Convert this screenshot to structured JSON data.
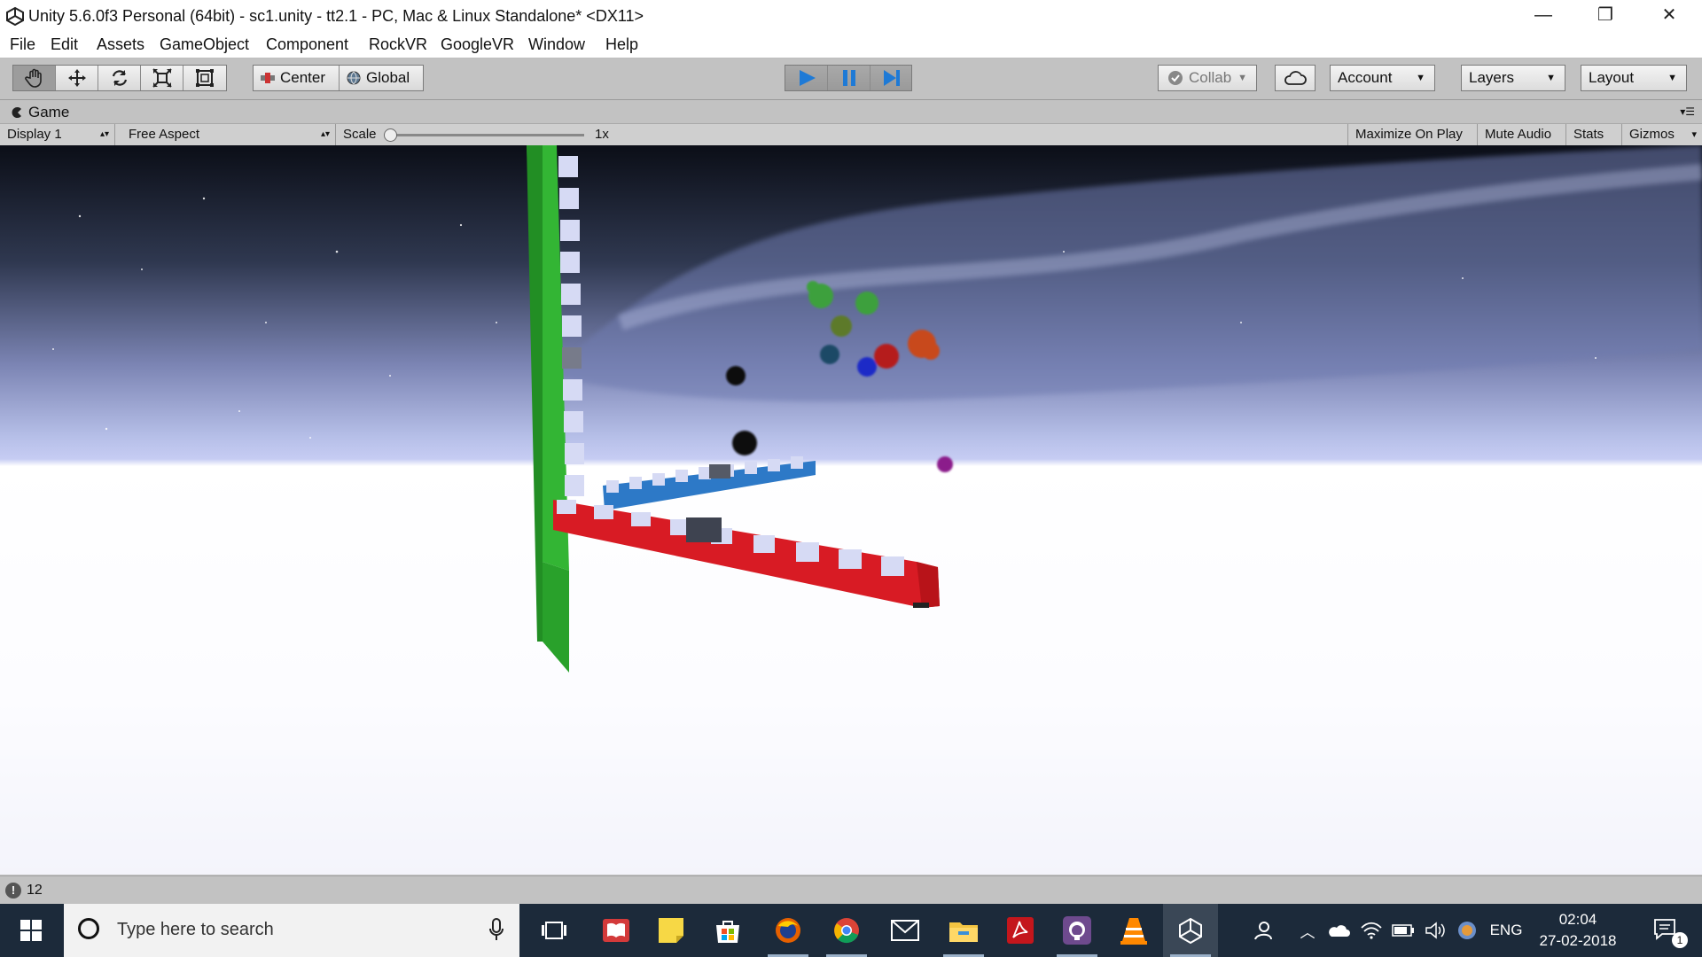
{
  "window": {
    "title": "Unity 5.6.0f3 Personal (64bit) - sc1.unity - tt2.1 - PC, Mac & Linux Standalone* <DX11>",
    "minimize": "—",
    "restore": "❐",
    "close": "✕"
  },
  "menu": [
    "File",
    "Edit",
    "Assets",
    "GameObject",
    "Component",
    "RockVR",
    "GoogleVR",
    "Window",
    "Help"
  ],
  "toolbar": {
    "tools": [
      "hand-icon",
      "move-icon",
      "rotate-icon",
      "scale-icon",
      "rect-icon"
    ],
    "pivot_label": "Center",
    "space_label": "Global",
    "collab_label": "Collab",
    "account_label": "Account",
    "layers_label": "Layers",
    "layout_label": "Layout",
    "play_color": "#1e7ad6"
  },
  "game_view": {
    "tab_label": "Game",
    "display": "Display 1",
    "aspect": "Free Aspect",
    "scale_label": "Scale",
    "scale_value": "1x",
    "scale_slider_value": 0,
    "maximize": "Maximize On Play",
    "mute": "Mute Audio",
    "stats": "Stats",
    "gizmos": "Gizmos"
  },
  "status": {
    "count": "12"
  },
  "taskbar": {
    "search_placeholder": "Type here to search",
    "apps": [
      "task-view-icon",
      "reader-icon",
      "sticky-notes-icon",
      "store-icon",
      "firefox-icon",
      "chrome-icon",
      "mail-icon",
      "file-explorer-icon",
      "acrobat-icon",
      "github-icon",
      "vlc-icon",
      "unity-icon"
    ],
    "language": "ENG",
    "time": "02:04",
    "date": "27-02-2018",
    "notifications": "1"
  },
  "colors": {
    "green_bar": "#33b534",
    "blue_bar": "#2d79c7",
    "red_bar": "#d81b24"
  }
}
